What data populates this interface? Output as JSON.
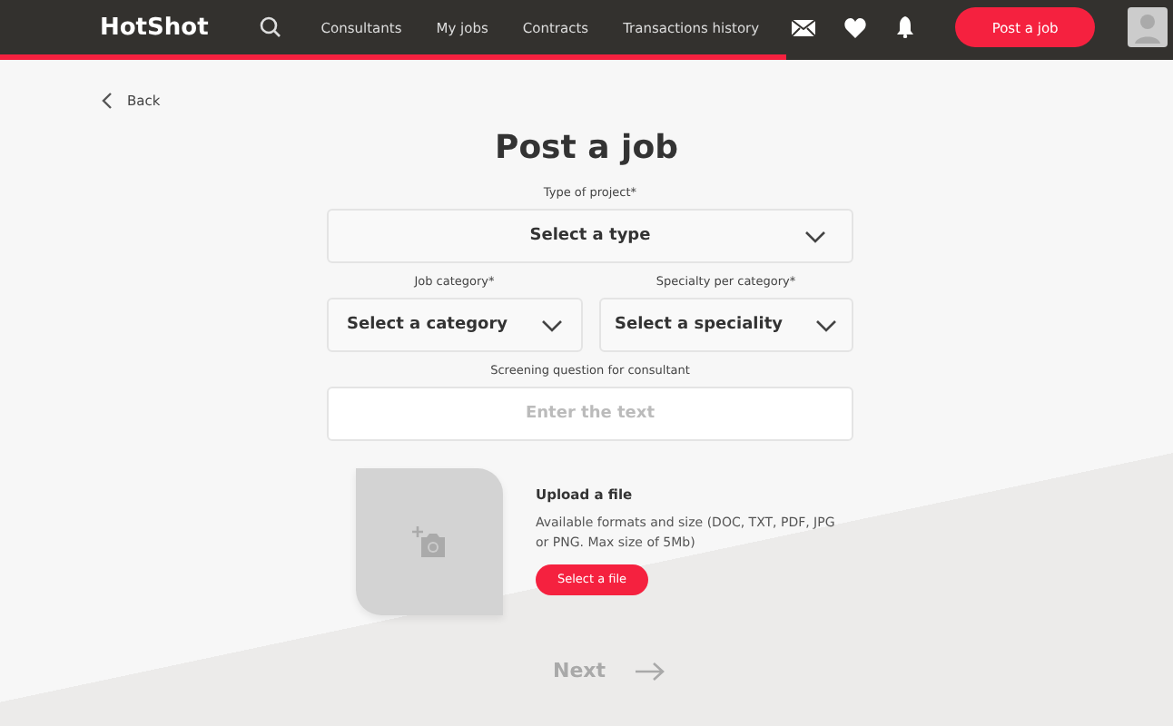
{
  "header": {
    "logo": "HotShot",
    "nav": [
      {
        "label": "Consultants"
      },
      {
        "label": "My jobs"
      },
      {
        "label": "Contracts"
      },
      {
        "label": "Transactions history"
      }
    ],
    "post_button": "Post a job"
  },
  "progress": {
    "level": 0.67
  },
  "back": "Back",
  "title": "Post a job",
  "type_field": {
    "label": "Type of project*",
    "value": "Select a type"
  },
  "category_fields": [
    {
      "label": "Job category*",
      "value": "Select a category"
    },
    {
      "label": "Specialty per category*",
      "value": "Select a speciality"
    }
  ],
  "screening": {
    "label": "Screening question for consultant",
    "placeholder": "Enter the text"
  },
  "upload": {
    "title": "Upload a file",
    "description": "Available formats and size (DOC, TXT, PDF, JPG or PNG. Max size of 5Mb)",
    "button": "Select a file"
  },
  "next": {
    "label": "Next",
    "disabled": true
  }
}
